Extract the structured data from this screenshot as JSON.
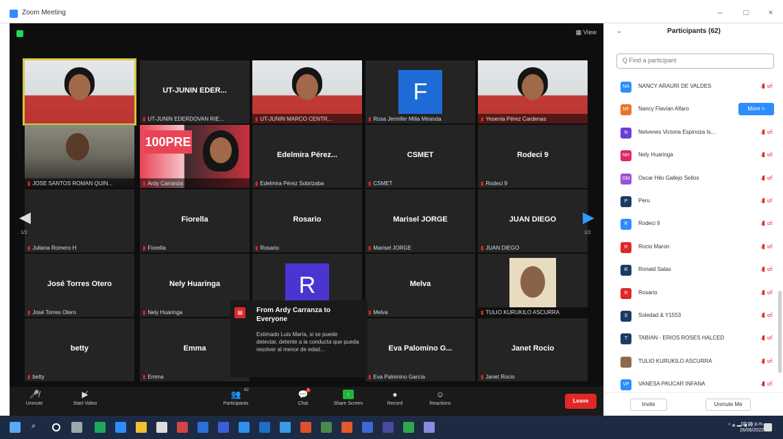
{
  "window": {
    "title": "Zoom Meeting"
  },
  "meeting": {
    "view_label": "View"
  },
  "tiles": [
    {
      "name": "",
      "tag": "",
      "type": "video-light",
      "active": true
    },
    {
      "name": "UT-JUNIN EDER...",
      "tag": "UT-JUNIN EDERDOVAN RIE...",
      "type": "name"
    },
    {
      "name": "",
      "tag": "UT-JUNIN MARCO CENTR...",
      "type": "video-light"
    },
    {
      "name": "",
      "tag": "Rosa Jennifer Milla Miranda",
      "type": "avatar",
      "letter": "F"
    },
    {
      "name": "",
      "tag": "Yesenia Pérez Cardenas",
      "type": "video-light"
    },
    {
      "name": "",
      "tag": "JOSE SANTOS ROMAN QUIN...",
      "type": "video-dark"
    },
    {
      "name": "",
      "tag": "Ardy Carranza",
      "type": "video-pink",
      "banner": "100PRE"
    },
    {
      "name": "Edelmira Pérez...",
      "tag": "Edelmira Pérez Sobrizaba",
      "type": "name"
    },
    {
      "name": "CSMET",
      "tag": "CSMET",
      "type": "name"
    },
    {
      "name": "Rodeci 9",
      "tag": "Rodeci 9",
      "type": "name"
    },
    {
      "name": "",
      "tag": "Juliana Romero H",
      "type": "name"
    },
    {
      "name": "Fiorella",
      "tag": "Fiorella",
      "type": "name"
    },
    {
      "name": "Rosario",
      "tag": "Rosario",
      "type": "name"
    },
    {
      "name": "Marisel JORGE",
      "tag": "Marisel JORGE",
      "type": "name"
    },
    {
      "name": "JUAN DIEGO",
      "tag": "JUAN DIEGO",
      "type": "name"
    },
    {
      "name": "José Torres Otero",
      "tag": "José Torres Otero",
      "type": "name"
    },
    {
      "name": "Nely Huaringa",
      "tag": "Nely Huaringa",
      "type": "name"
    },
    {
      "name": "",
      "tag": "",
      "type": "avatar-purple",
      "letter": "R"
    },
    {
      "name": "Melva",
      "tag": "Melva",
      "type": "name"
    },
    {
      "name": "",
      "tag": "TULIO KURUKILO ASCURRA",
      "type": "photo"
    },
    {
      "name": "betty",
      "tag": "betty",
      "type": "name"
    },
    {
      "name": "Emma",
      "tag": "Emma",
      "type": "name"
    },
    {
      "name": "",
      "tag": "",
      "type": "hidden"
    },
    {
      "name": "Eva Palomino G...",
      "tag": "Eva Palomino García",
      "type": "name"
    },
    {
      "name": "Janet Rocio",
      "tag": "Janet Rocio",
      "type": "name"
    }
  ],
  "nav": {
    "left_num": "1/2",
    "right_num": "1/2"
  },
  "chat": {
    "icon": "chat-icon",
    "from": "From Ardy Carranza to Everyone",
    "message": "Estimado Luis María, si se puede detectar, detente a la conducta que pueda resolver al menor de edad..."
  },
  "toolbar": {
    "unmute": "Unmute",
    "start_video": "Start Video",
    "participants": "Participants",
    "participants_count": "62",
    "chat": "Chat",
    "chat_badge": "1",
    "share": "Share Screen",
    "record": "Record",
    "reactions": "Reactions",
    "leave": "Leave"
  },
  "panel": {
    "title": "Participants (62)",
    "search_placeholder": "Q Find a participant",
    "more_label": "More >",
    "invite": "Invite",
    "unmute_me": "Unmute Me",
    "participants": [
      {
        "initials": "NA",
        "color": "#2d8cff",
        "name": "NANCY ARAURI DE VALDES"
      },
      {
        "initials": "NF",
        "color": "#e8742a",
        "name": "Nancy Flavían Alfaro",
        "more": true
      },
      {
        "initials": "N",
        "color": "#6b3ed6",
        "name": "Nelvenes Victoria Espinoza Is..."
      },
      {
        "initials": "NH",
        "color": "#e02860",
        "name": "Nely Huaringa"
      },
      {
        "initials": "OM",
        "color": "#9b4fd6",
        "name": "Oscar Hilo Gallejo Sellos"
      },
      {
        "initials": "P",
        "color": "#1c3a66",
        "name": "Peru"
      },
      {
        "initials": "R",
        "color": "#2d8cff",
        "name": "Rodeci 9"
      },
      {
        "initials": "R",
        "color": "#e02828",
        "name": "Rocio Maron"
      },
      {
        "initials": "R",
        "color": "#1c3a66",
        "name": "Ronald Salas"
      },
      {
        "initials": "R",
        "color": "#e02828",
        "name": "Rosario"
      },
      {
        "initials": "S",
        "color": "#1c3a66",
        "name": "Soledad & Y1553"
      },
      {
        "initials": "T",
        "color": "#1c3a66",
        "name": "TABIAN - ERIOS ROSES HALCED"
      },
      {
        "initials": "",
        "color": "#8c6a4a",
        "name": "TULIO KURUKILO ASCURRA"
      },
      {
        "initials": "VP",
        "color": "#2d8cff",
        "name": "VANESA PAUCAR INFANA"
      }
    ]
  },
  "taskbar": {
    "clock_time": "05:05 p.m.",
    "clock_date": "26/06/2022"
  }
}
